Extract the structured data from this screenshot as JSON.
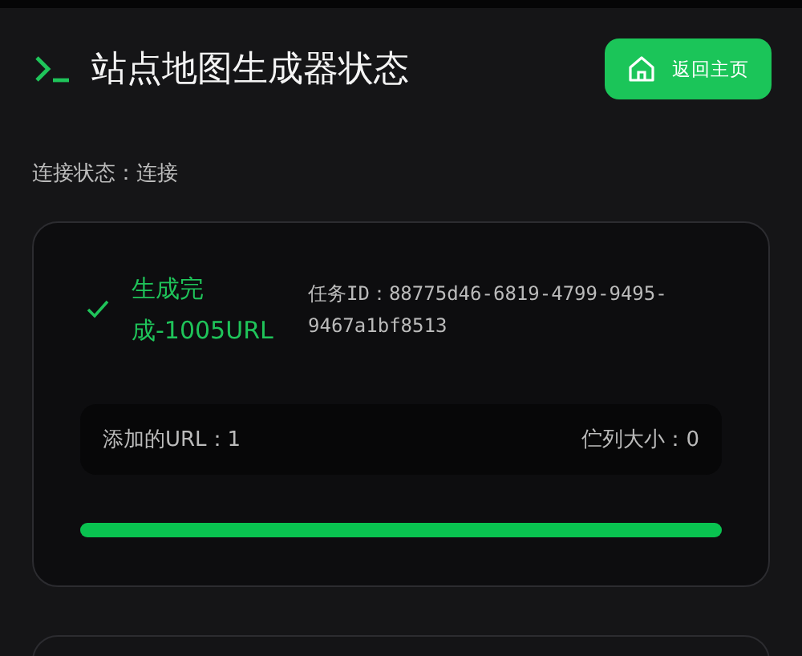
{
  "header": {
    "title": "站点地图生成器状态",
    "home_button": "返回主页"
  },
  "connection": {
    "text": "连接状态：连接"
  },
  "job": {
    "status": "生成完成-1005URL",
    "done": true,
    "task_id": "任务ID：88775d46-6819-4799-9495-9467a1bf8513",
    "stats": [
      "添加的URL：1",
      "伫列大小：0"
    ],
    "progress": {
      "level": 1
    }
  }
}
